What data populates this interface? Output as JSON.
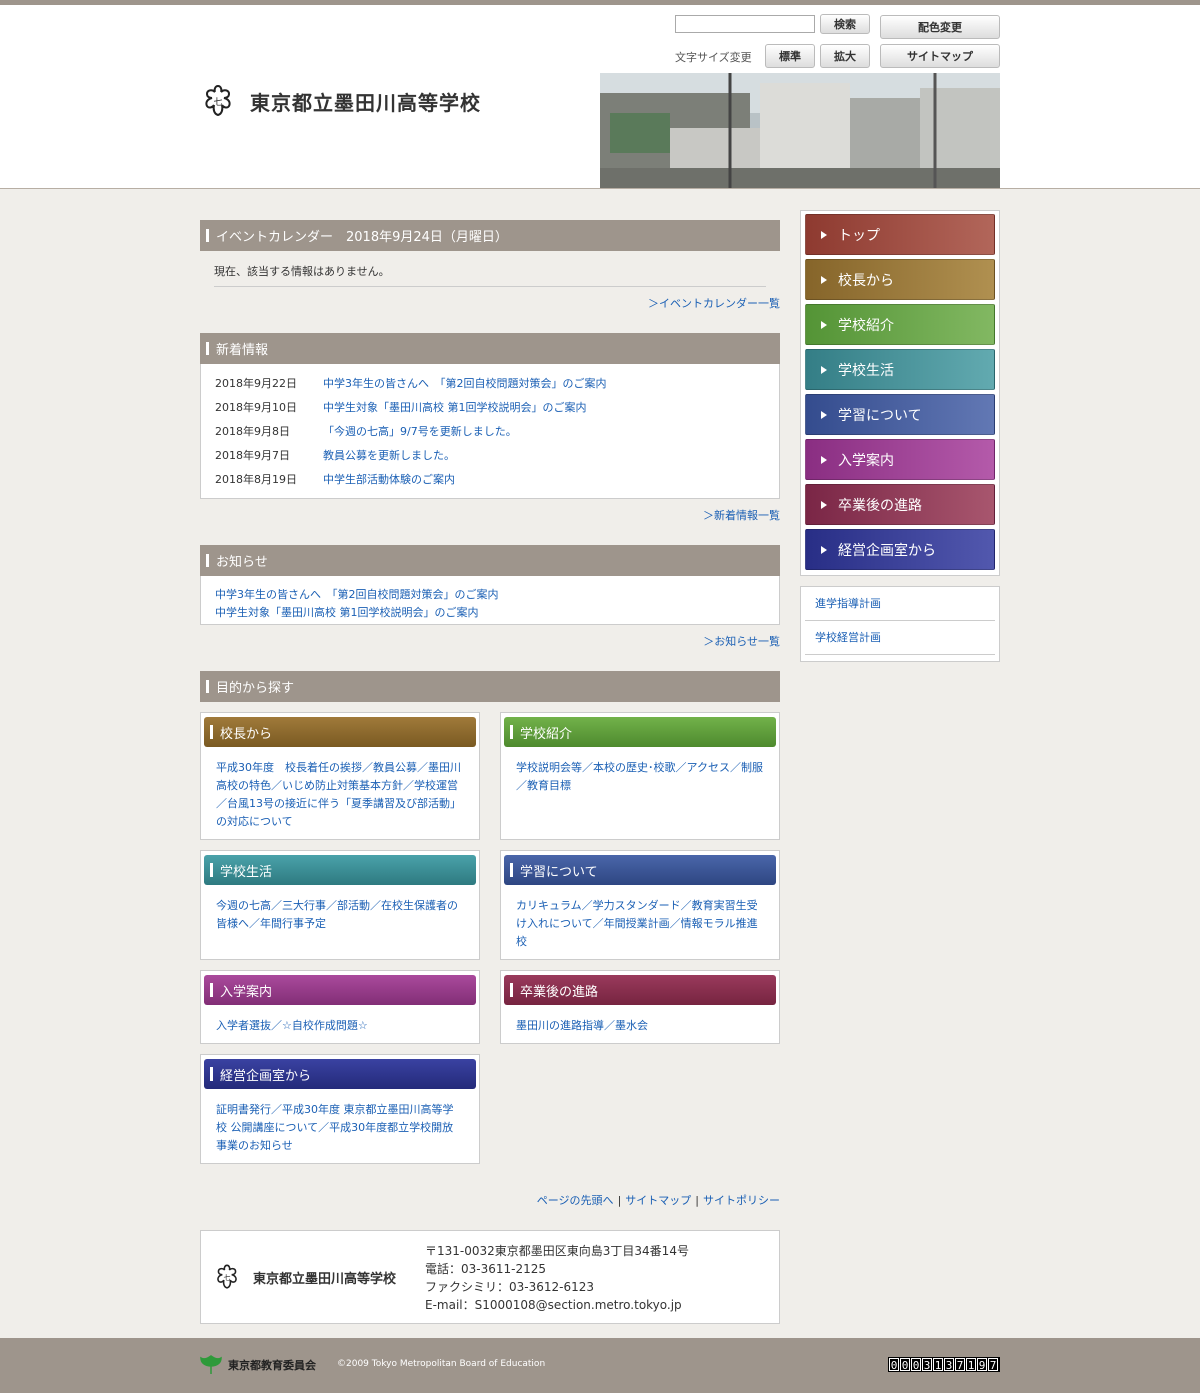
{
  "header": {
    "school_name": "東京都立墨田川高等学校",
    "search_button": "検索",
    "color_button": "配色変更",
    "font_size_label": "文字サイズ変更",
    "font_std": "標準",
    "font_big": "拡大",
    "sitemap_button": "サイトマップ"
  },
  "event": {
    "title": "イベントカレンダー　2018年9月24日（月曜日）",
    "text": "現在、該当する情報はありません。",
    "more": "＞イベントカレンダー一覧"
  },
  "news": {
    "title": "新着情報",
    "items": [
      {
        "date": "2018年9月22日",
        "text": "中学3年生の皆さんへ　「第2回自校問題対策会」のご案内"
      },
      {
        "date": "2018年9月10日",
        "text": "中学生対象「墨田川高校 第1回学校説明会」のご案内"
      },
      {
        "date": "2018年9月8日",
        "text": "「今週の七高」9/7号を更新しました。"
      },
      {
        "date": "2018年9月7日",
        "text": "教員公募を更新しました。"
      },
      {
        "date": "2018年8月19日",
        "text": "中学生部活動体験のご案内"
      }
    ],
    "more": "＞新着情報一覧"
  },
  "notice": {
    "title": "お知らせ",
    "items": [
      "中学3年生の皆さんへ　「第2回自校問題対策会」のご案内",
      "中学生対象「墨田川高校 第1回学校説明会」のご案内"
    ],
    "more": "＞お知らせ一覧"
  },
  "purpose": {
    "title": "目的から探す",
    "cards": [
      {
        "title": "校長から",
        "color": "#8c6a2a",
        "body": "平成30年度　校長着任の挨拶／教員公募／墨田川高校の特色／いじめ防止対策基本方針／学校運営／台風13号の接近に伴う「夏季講習及び部活動」の対応について"
      },
      {
        "title": "学校紹介",
        "color": "#5fa03a",
        "body": "学校説明会等／本校の歴史･校歌／アクセス／制服／教育目標"
      },
      {
        "title": "学校生活",
        "color": "#3d8f96",
        "body": "今週の七高／三大行事／部活動／在校生保護者の皆様へ／年間行事予定"
      },
      {
        "title": "学習について",
        "color": "#3a5496",
        "body": "カリキュラム／学力スタンダード／教育実習生受け入れについて／年間授業計画／情報モラル推進校"
      },
      {
        "title": "入学案内",
        "color": "#9a3a8a",
        "body": "入学者選抜／☆自校作成問題☆"
      },
      {
        "title": "卒業後の進路",
        "color": "#8a2e4e",
        "body": "墨田川の進路指導／墨水会"
      },
      {
        "title": "経営企画室から",
        "color": "#2e3590",
        "body": "証明書発行／平成30年度 東京都立墨田川高等学校 公開講座について／平成30年度都立学校開放事業のお知らせ"
      }
    ]
  },
  "footer_links": {
    "top": "ページの先頭へ",
    "sitemap": "サイトマップ",
    "policy": "サイトポリシー"
  },
  "address": {
    "name": "東京都立墨田川高等学校",
    "postal": "〒131-0032東京都墨田区東向島3丁目34番14号",
    "tel": "電話：03-3611-2125",
    "fax": "ファクシミリ：03-3612-6123",
    "email": "E-mail：S1000108@section.metro.tokyo.jp"
  },
  "nav": [
    {
      "label": "トップ",
      "color": "#a04a3e"
    },
    {
      "label": "校長から",
      "color": "#9a7a3c"
    },
    {
      "label": "学校紹介",
      "color": "#6aa448"
    },
    {
      "label": "学校生活",
      "color": "#46949a"
    },
    {
      "label": "学習について",
      "color": "#4660a0"
    },
    {
      "label": "入学案内",
      "color": "#9e3e94"
    },
    {
      "label": "卒業後の進路",
      "color": "#8e3456"
    },
    {
      "label": "経営企画室から",
      "color": "#373c96"
    }
  ],
  "sub_nav": [
    "進学指導計画",
    "学校経営計画"
  ],
  "foot": {
    "board": "東京都教育委員会",
    "copyright": "©2009 Tokyo Metropolitan Board of Education",
    "counter": "0003137197"
  }
}
